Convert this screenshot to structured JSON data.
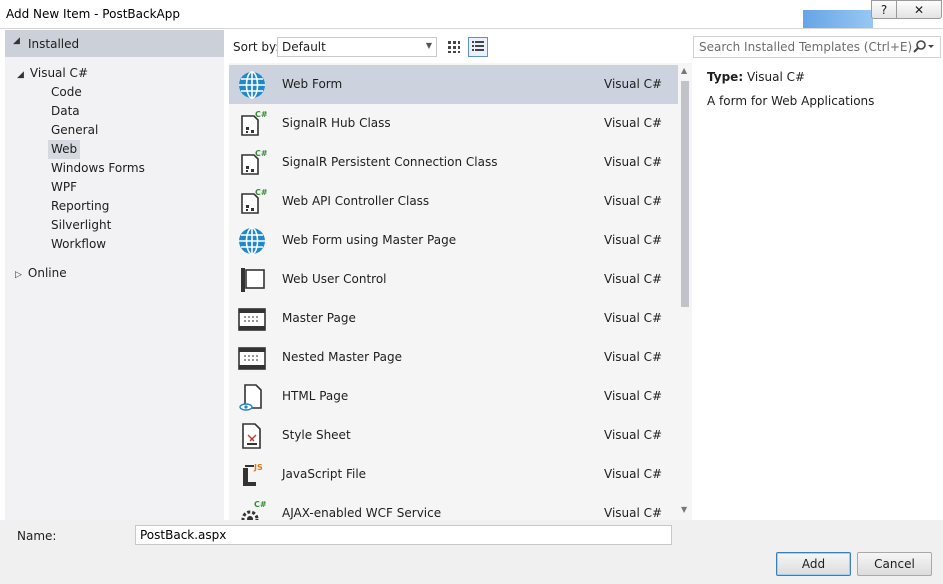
{
  "window": {
    "title": "Add New Item - PostBackApp",
    "help_label": "?",
    "close_label": "✕"
  },
  "left_pane": {
    "header": "Installed",
    "tree": {
      "root": "Visual C#",
      "children": [
        "Code",
        "Data",
        "General",
        "Web",
        "Windows Forms",
        "WPF",
        "Reporting",
        "Silverlight",
        "Workflow"
      ],
      "selected": "Web",
      "online": "Online"
    }
  },
  "toolbar": {
    "sort_label": "Sort by:",
    "sort_value": "Default",
    "search_placeholder": "Search Installed Templates (Ctrl+E)"
  },
  "templates": [
    {
      "name": "Web Form",
      "lang": "Visual C#",
      "icon": "globe-icon",
      "selected": true
    },
    {
      "name": "SignalR Hub Class",
      "lang": "Visual C#",
      "icon": "csharp-class-icon"
    },
    {
      "name": "SignalR Persistent Connection Class",
      "lang": "Visual C#",
      "icon": "csharp-class-icon"
    },
    {
      "name": "Web API Controller Class",
      "lang": "Visual C#",
      "icon": "csharp-class-icon"
    },
    {
      "name": "Web Form using Master Page",
      "lang": "Visual C#",
      "icon": "globe-icon"
    },
    {
      "name": "Web User Control",
      "lang": "Visual C#",
      "icon": "user-control-icon"
    },
    {
      "name": "Master Page",
      "lang": "Visual C#",
      "icon": "master-page-icon"
    },
    {
      "name": "Nested Master Page",
      "lang": "Visual C#",
      "icon": "master-page-icon"
    },
    {
      "name": "HTML Page",
      "lang": "Visual C#",
      "icon": "html-page-icon"
    },
    {
      "name": "Style Sheet",
      "lang": "Visual C#",
      "icon": "style-sheet-icon"
    },
    {
      "name": "JavaScript File",
      "lang": "Visual C#",
      "icon": "javascript-file-icon"
    },
    {
      "name": "AJAX-enabled WCF Service",
      "lang": "Visual C#",
      "icon": "wcf-service-icon"
    }
  ],
  "info": {
    "type_label": "Type:",
    "type_value": "Visual C#",
    "description": "A form for Web Applications"
  },
  "bottom": {
    "name_label": "Name:",
    "name_value": "PostBack.aspx",
    "add_label": "Add",
    "cancel_label": "Cancel"
  },
  "colors": {
    "selection": "#ccd2de",
    "globe_blue": "#1e88c9",
    "csharp_green": "#388a34",
    "js_orange": "#e07b10"
  }
}
